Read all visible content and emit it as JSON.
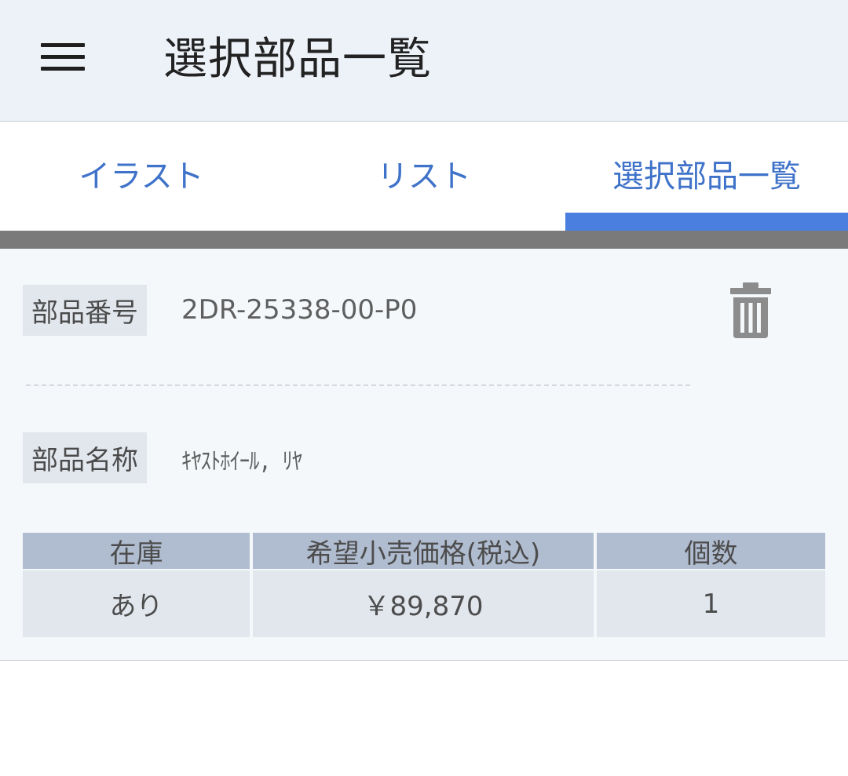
{
  "appbar": {
    "title": "選択部品一覧",
    "menu_icon": "hamburger-menu-icon"
  },
  "tabs": [
    {
      "label": "イラスト",
      "active": false
    },
    {
      "label": "リスト",
      "active": false
    },
    {
      "label": "選択部品一覧",
      "active": true
    }
  ],
  "colors": {
    "tab_text": "#3f72c9",
    "tab_indicator": "#4a7fe0",
    "appbar_bg": "#edf2f9"
  },
  "part": {
    "number_label": "部品番号",
    "number": "2DR-25338-00-P0",
    "name_label": "部品名称",
    "name": "ｷﾔｽﾄﾎｲｰﾙ, ﾘﾔ",
    "delete_icon": "trash-icon",
    "table": {
      "headers": [
        "在庫",
        "希望小売価格(税込)",
        "個数"
      ],
      "values": [
        "あり",
        "￥89,870",
        "1"
      ]
    }
  }
}
